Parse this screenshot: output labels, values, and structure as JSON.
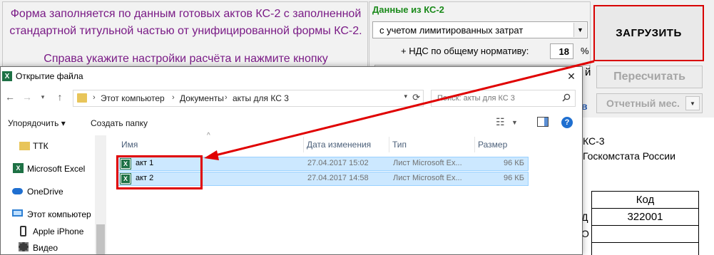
{
  "info_panel": {
    "line1": "Форма заполняется по данным готовых актов КС-2 с заполненной",
    "line2": "стандартной титульной частью от унифицированной формы КС-2.",
    "line3": "Справа укажите настройки расчёта и нажмите кнопку"
  },
  "ks2_panel": {
    "title": "Данные из КС-2",
    "mode_selected": "с учетом лимитированных затрат",
    "vat_label": "+ НДС по общему нормативу:",
    "vat_value": "18",
    "vat_unit": "%"
  },
  "buttons": {
    "load": "ЗАГРУЗИТЬ",
    "recalc": "Пересчитать",
    "month": "Отчетный мес."
  },
  "sheet": {
    "stray_char": "й",
    "stray_char2": "в",
    "ks3_text": "КС-3",
    "goskomstat_text": "Госкомстата России",
    "code_header": "Код",
    "code_value": "322001",
    "row_label_d": "Д",
    "row_label_o": "О"
  },
  "dialog": {
    "title": "Открытие файла",
    "breadcrumb": [
      "Этот компьютер",
      "Документы",
      "акты для КС 3"
    ],
    "search_placeholder": "Поиск: акты для КС 3",
    "toolbar": {
      "organize": "Упорядочить ▾",
      "new_folder": "Создать папку"
    },
    "nav_items": [
      {
        "label": "ТТК",
        "icon": "folder-icon"
      },
      {
        "label": "Microsoft Excel",
        "icon": "excel-icon"
      },
      {
        "label": "OneDrive",
        "icon": "onedrive-icon"
      },
      {
        "label": "Этот компьютер",
        "icon": "computer-icon"
      },
      {
        "label": "Apple iPhone",
        "icon": "phone-icon"
      },
      {
        "label": "Видео",
        "icon": "video-icon"
      }
    ],
    "columns": [
      "Имя",
      "Дата изменения",
      "Тип",
      "Размер"
    ],
    "files": [
      {
        "name": "акт 1",
        "date": "27.04.2017 15:02",
        "type": "Лист Microsoft Ex...",
        "size": "96 КБ"
      },
      {
        "name": "акт 2",
        "date": "27.04.2017 14:58",
        "type": "Лист Microsoft Ex...",
        "size": "96 КБ"
      }
    ]
  },
  "colors": {
    "info_text": "#7a1b86",
    "ks_title": "#1a8a1a",
    "highlight_red": "#e00000",
    "selection": "#cce8ff"
  }
}
